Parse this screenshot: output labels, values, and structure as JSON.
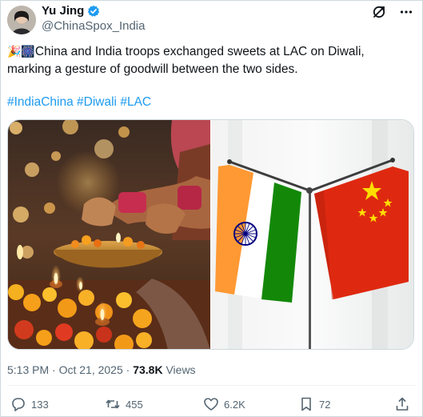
{
  "author": {
    "display_name": "Yu Jing",
    "handle": "@ChinaSpox_India"
  },
  "icons": {
    "avatar": "avatar",
    "verified": "verified-badge-icon",
    "grok": "grok-icon",
    "more": "more-icon",
    "reply": "reply-icon",
    "retweet": "retweet-icon",
    "like": "like-icon",
    "bookmark": "bookmark-icon",
    "share": "share-icon"
  },
  "tweet": {
    "emoji": "🎉🎆",
    "text_line1": "China and India troops exchanged sweets at LAC on Diwali,",
    "text_line2": "marking a gesture of goodwill between the two sides.",
    "hashtags": [
      "#IndiaChina",
      "#Diwali",
      "#LAC"
    ]
  },
  "meta": {
    "time": "5:13 PM",
    "separator": " · ",
    "date": "Oct 21, 2025",
    "views_count": "73.8K",
    "views_label": " Views"
  },
  "actions": {
    "reply_count": "133",
    "retweet_count": "455",
    "like_count": "6.2K",
    "bookmark_count": "72"
  },
  "colors": {
    "accent": "#1d9bf0",
    "text": "#0f1419",
    "secondary": "#536471",
    "border": "#cfd9de",
    "india_saffron": "#ff9933",
    "india_green": "#138808",
    "china_red": "#de2910",
    "china_yellow": "#ffde00"
  }
}
